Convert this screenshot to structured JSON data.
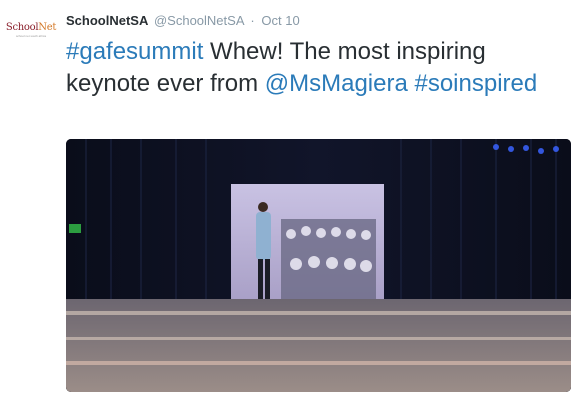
{
  "tweet": {
    "avatar_logo": {
      "part1": "School",
      "part2": "Net",
      "tagline": "school net south africa"
    },
    "fullname": "SchoolNetSA",
    "screenname": "@SchoolNetSA",
    "separator": "·",
    "timestamp": "Oct 10",
    "text": {
      "hashtag1": "#gafesummit",
      "body": " Whew! The most inspiring keynote ever from ",
      "mention": "@MsMagiera",
      "hashtag2": "#soinspired"
    },
    "colors": {
      "link": "#2b7bb9",
      "name": "#292f33",
      "meta": "#8899a6"
    },
    "media": {
      "type": "photo",
      "icon": "photo-attachment"
    }
  }
}
